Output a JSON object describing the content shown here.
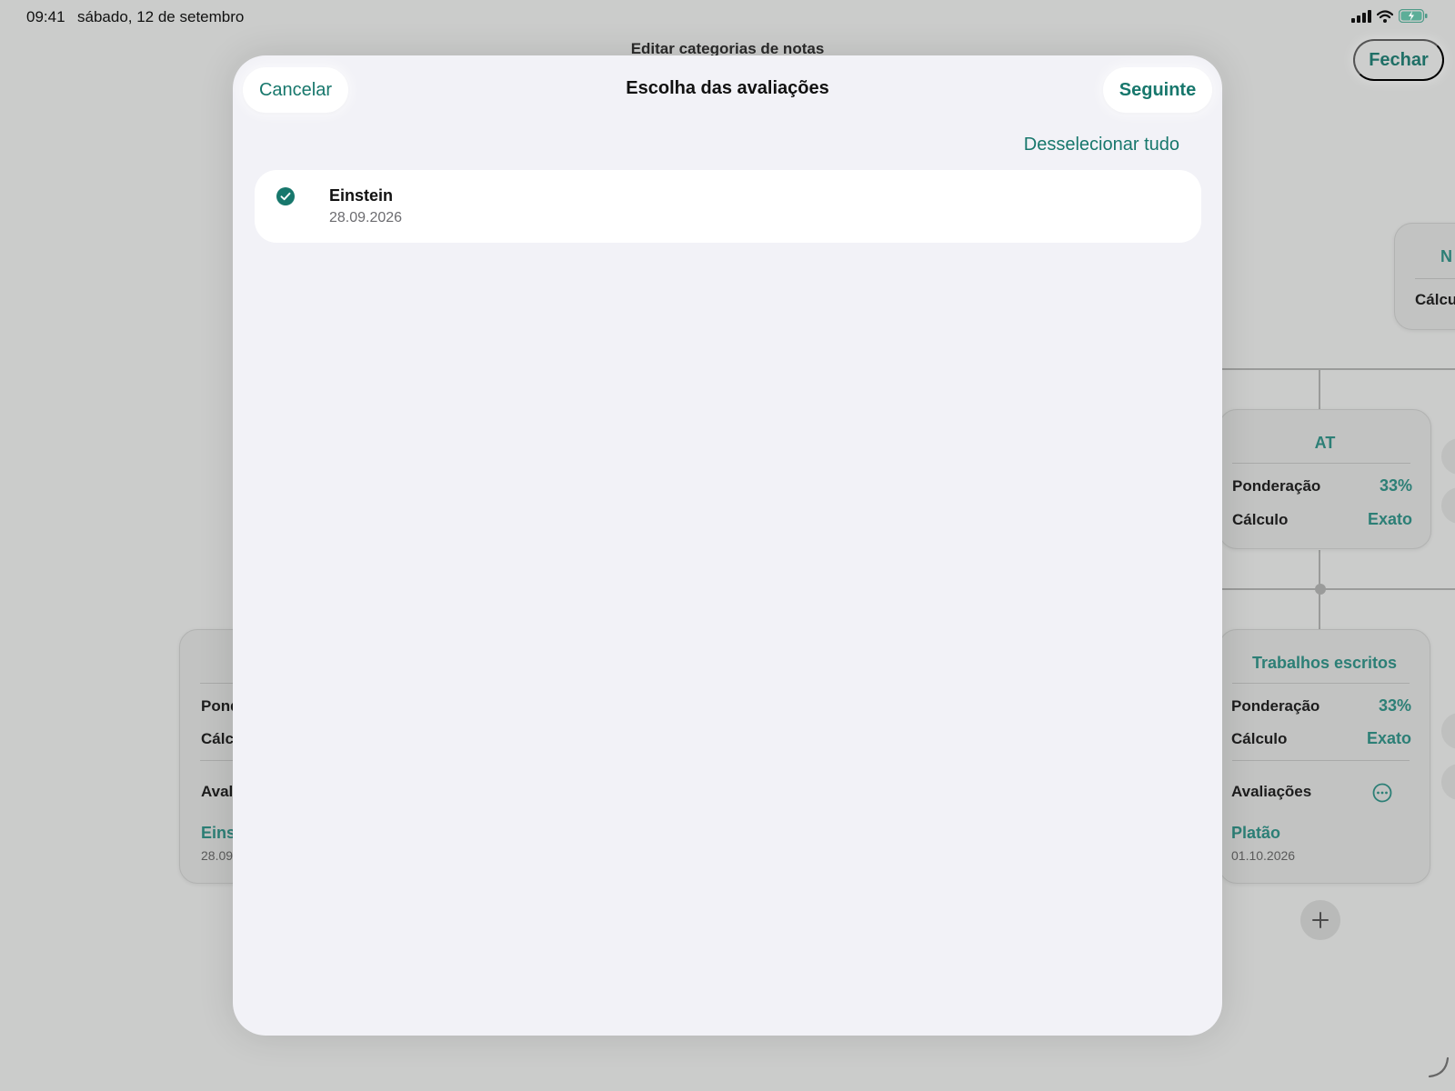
{
  "status_bar": {
    "time": "09:41",
    "date": "sábado, 12 de setembro"
  },
  "background": {
    "title": "Editar categorias de notas",
    "close_label": "Fechar",
    "top_card": {
      "title": "N",
      "calc_label": "Cálcu"
    },
    "at_card": {
      "title": "AT",
      "weight_label": "Ponderação",
      "weight_value": "33%",
      "calc_label": "Cálculo",
      "calc_value": "Exato"
    },
    "written_card": {
      "title": "Trabalhos escritos",
      "weight_label": "Ponderação",
      "weight_value": "33%",
      "calc_label": "Cálculo",
      "calc_value": "Exato",
      "assessments_label": "Avaliações",
      "assessment_name": "Platão",
      "assessment_date": "01.10.2026"
    },
    "left_card": {
      "weight_label": "Pond",
      "calc_label": "Cálc",
      "assessments_label": "Aval",
      "assessment_name": "Eins",
      "assessment_date": "28.09"
    }
  },
  "modal": {
    "title": "Escolha das avaliações",
    "cancel_label": "Cancelar",
    "next_label": "Seguinte",
    "deselect_label": "Desselecionar tudo",
    "items": [
      {
        "name": "Einstein",
        "date": "28.09.2026",
        "selected": true
      }
    ]
  },
  "colors": {
    "accent": "#17776c",
    "background": "#cbcccb",
    "modal": "#f2f2f7"
  }
}
